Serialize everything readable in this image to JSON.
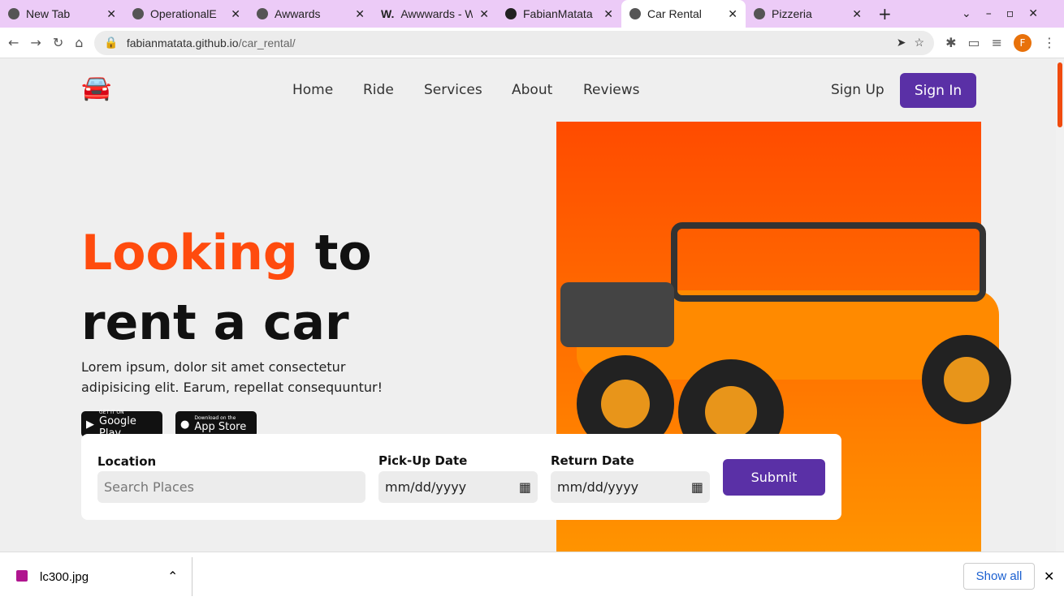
{
  "browser": {
    "tabs": [
      {
        "title": "New Tab"
      },
      {
        "title": "OperationalE"
      },
      {
        "title": "Awwards"
      },
      {
        "title": "Awwwards - W"
      },
      {
        "title": "FabianMatata"
      },
      {
        "title": "Car Rental"
      },
      {
        "title": "Pizzeria"
      }
    ],
    "url_host": "fabianmatata.github.io",
    "url_path": "/car_rental/",
    "profile_initial": "F"
  },
  "nav": {
    "items": [
      "Home",
      "Ride",
      "Services",
      "About",
      "Reviews"
    ],
    "signup": "Sign Up",
    "signin": "Sign In"
  },
  "hero": {
    "title_highlight": "Looking",
    "title_rest": " to",
    "title_line2": "rent a car",
    "description": "Lorem ipsum, dolor sit amet consectetur adipisicing elit. Earum, repellat consequuntur!",
    "google_small": "GET IT ON",
    "google": "Google Play",
    "apple_small": "Download on the",
    "apple": "App Store"
  },
  "form": {
    "location_label": "Location",
    "location_placeholder": "Search Places",
    "pickup_label": "Pick-Up Date",
    "pickup_value": "mm/dd/yyyy",
    "return_label": "Return Date",
    "return_value": "mm/dd/yyyy",
    "submit": "Submit"
  },
  "downloads": {
    "file": "lc300.jpg",
    "show_all": "Show all"
  },
  "colors": {
    "accent": "#ff4b0e",
    "purple": "#5a30a6"
  }
}
